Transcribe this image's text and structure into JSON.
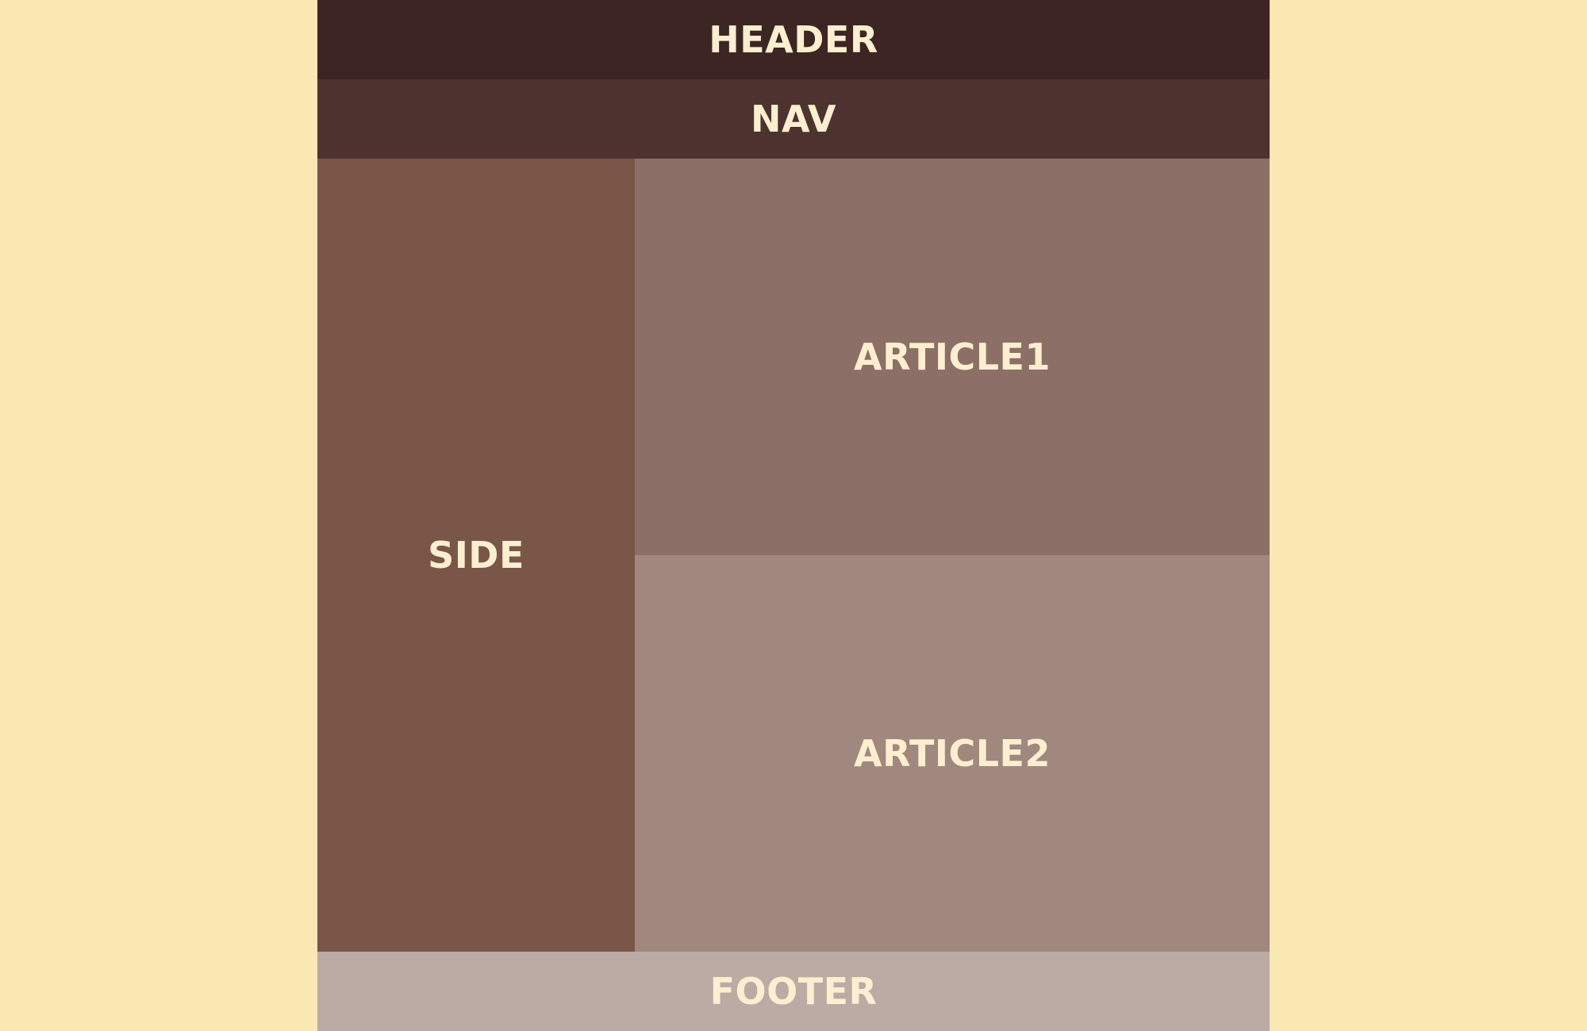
{
  "layout": {
    "header": "HEADER",
    "nav": "NAV",
    "side": "SIDE",
    "article1": "ARTICLE1",
    "article2": "ARTICLE2",
    "footer": "FOOTER"
  },
  "colors": {
    "page_background": "#F9E8B2",
    "header": "#3D2523",
    "nav": "#4D3230",
    "side": "#7A5649",
    "article1": "#8C6F66",
    "article2": "#A1887E",
    "footer": "#BCABA4",
    "label_text": "#FBEFD0"
  }
}
